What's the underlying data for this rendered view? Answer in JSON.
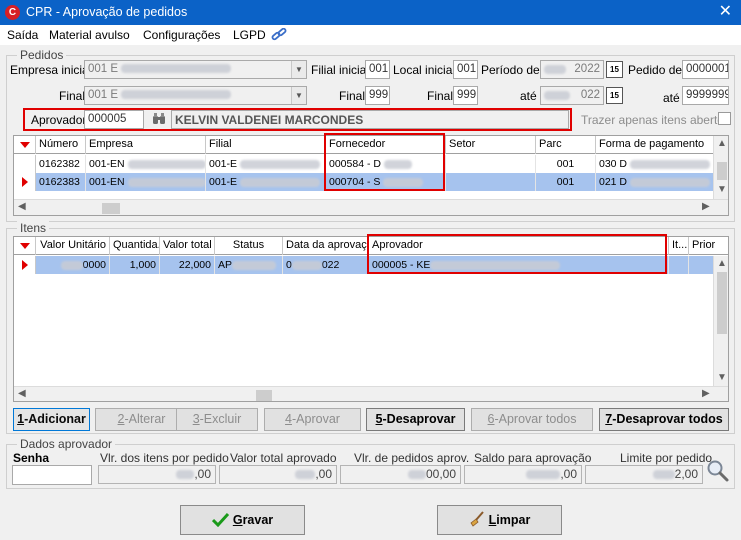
{
  "window": {
    "title": "CPR - Aprovação de pedidos",
    "logo_letter": "C",
    "close_glyph": "✕"
  },
  "menu": [
    "Saída",
    "Material avulso",
    "Configurações",
    "LGPD"
  ],
  "pedidos": {
    "group_title": "Pedidos",
    "empresa_inicial_label": "Empresa inicial",
    "empresa_inicial_value": "001 E",
    "empresa_final_label": "Final",
    "empresa_final_value": "001 E",
    "filial_inicial_label": "Filial inicial",
    "filial_inicial_value": "001",
    "filial_final_label": "Final",
    "filial_final_value": "999",
    "local_inicial_label": "Local inicial",
    "local_inicial_value": "001",
    "local_final_label": "Final",
    "local_final_value": "999",
    "periodo_label": "Período de",
    "periodo_de_value": "2022",
    "periodo_ate_label": "até",
    "periodo_ate_value": "022",
    "pedido_de_label": "Pedido de",
    "pedido_de_value": "0000001",
    "pedido_ate_label": "até",
    "pedido_ate_value": "9999999",
    "cal_glyph": "15",
    "aprovador_label": "Aprovador",
    "aprovador_code": "000005",
    "aprovador_name": "KELVIN VALDENEI MARCONDES",
    "trazer_label": "Trazer apenas itens abertos",
    "columns": [
      "Número",
      "Empresa",
      "Filial",
      "Fornecedor",
      "Setor",
      "Parc",
      "Forma de pagamento"
    ],
    "rows": [
      [
        "0162382",
        "001-EN",
        "001-E",
        "000584 - D",
        "",
        "001",
        "030 D"
      ],
      [
        "0162383",
        "001-EN",
        "001-E",
        "000704 - S",
        "",
        "001",
        "021 D"
      ]
    ]
  },
  "itens": {
    "group_title": "Itens",
    "columns": [
      "Valor Unitário",
      "Quantida...",
      "Valor total",
      "Status",
      "Data da aprovação",
      "Aprovador",
      "It...",
      "Prior"
    ],
    "rows": [
      [
        "0000",
        "1,000",
        "22,000",
        "AP",
        "0",
        "022",
        "000005 - KE",
        "",
        ""
      ]
    ]
  },
  "buttons": [
    {
      "key": "1",
      "label": "-Adicionar",
      "state": "on"
    },
    {
      "key": "2",
      "label": "-Alterar",
      "state": "off"
    },
    {
      "key": "3",
      "label": "-Excluir",
      "state": "off"
    },
    {
      "key": "4",
      "label": "-Aprovar",
      "state": "off"
    },
    {
      "key": "5",
      "label": "-Desaprovar",
      "state": "on"
    },
    {
      "key": "6",
      "label": "-Aprovar todos",
      "state": "off"
    },
    {
      "key": "7",
      "label": "-Desaprovar todos",
      "state": "on"
    }
  ],
  "dados": {
    "group_title": "Dados aprovador",
    "senha_label": "Senha",
    "senha_value": "",
    "vlr_itens_label": "Vlr. dos itens por pedido",
    "vlr_itens_value": ",00",
    "valor_total_label": "Valor total aprovado",
    "valor_total_value": ",00",
    "vlr_pedidos_label": "Vlr. de pedidos aprov.",
    "vlr_pedidos_value": "00,00",
    "saldo_label": "Saldo para aprovação",
    "saldo_value": ",00",
    "limite_label": "Limite por pedido",
    "limite_value": "2,00"
  },
  "footer": {
    "gravar_key": "G",
    "gravar_rest": "ravar",
    "limpar_key": "L",
    "limpar_rest": "impar"
  },
  "colors": {
    "accent_red": "#e00000",
    "titlebar": "#0b62c7",
    "selection": "#a6c3ee"
  }
}
